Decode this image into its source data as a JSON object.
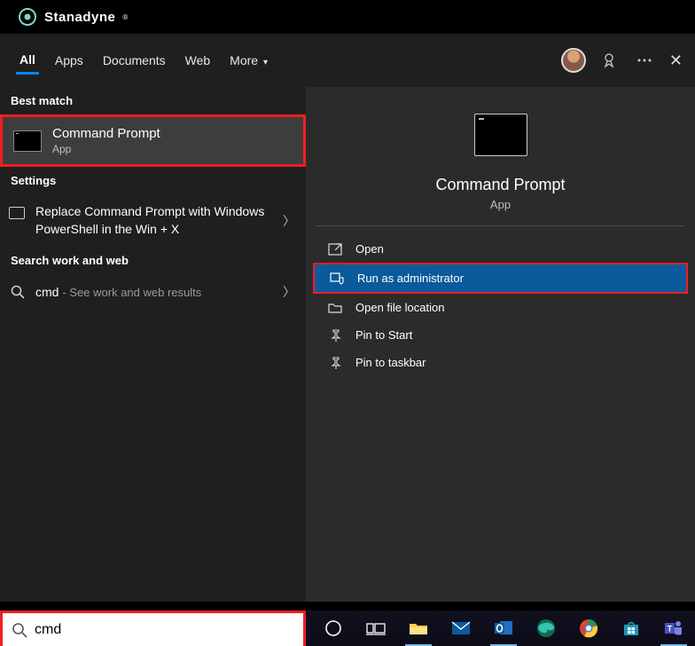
{
  "brand": {
    "name": "Stanadyne"
  },
  "tabs": {
    "items": [
      "All",
      "Apps",
      "Documents",
      "Web",
      "More"
    ],
    "active": 0
  },
  "left": {
    "best_match_header": "Best match",
    "best_match": {
      "title": "Command Prompt",
      "subtitle": "App"
    },
    "settings_header": "Settings",
    "settings_item": "Replace Command Prompt with Windows PowerShell in the Win + X",
    "web_header": "Search work and web",
    "web_term": "cmd",
    "web_sub": "- See work and web results"
  },
  "detail": {
    "title": "Command Prompt",
    "subtitle": "App",
    "actions": [
      {
        "label": "Open",
        "icon": "open"
      },
      {
        "label": "Run as administrator",
        "icon": "admin",
        "selected": true
      },
      {
        "label": "Open file location",
        "icon": "folder"
      },
      {
        "label": "Pin to Start",
        "icon": "pin"
      },
      {
        "label": "Pin to taskbar",
        "icon": "pin"
      }
    ]
  },
  "search": {
    "value": "cmd"
  },
  "taskbar": {
    "items": [
      {
        "name": "cortana-circle"
      },
      {
        "name": "task-view"
      },
      {
        "name": "file-explorer",
        "active": true
      },
      {
        "name": "mail"
      },
      {
        "name": "outlook",
        "active": true
      },
      {
        "name": "edge"
      },
      {
        "name": "chrome"
      },
      {
        "name": "store"
      },
      {
        "name": "teams",
        "active": true
      }
    ]
  }
}
